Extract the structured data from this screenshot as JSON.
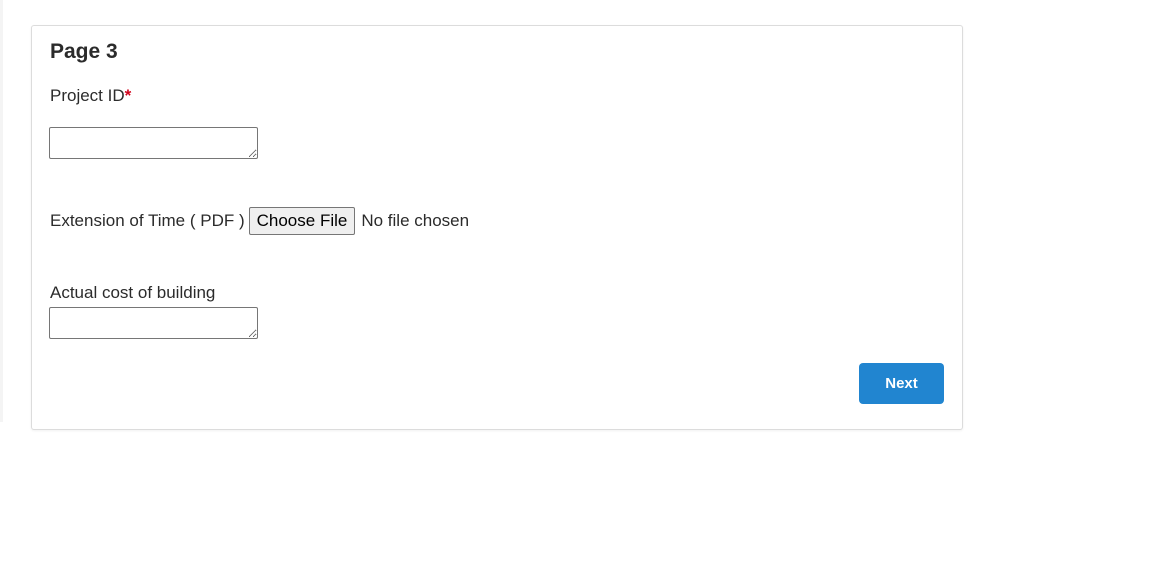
{
  "page": {
    "title": "Page 3"
  },
  "fields": {
    "project_id": {
      "label": "Project ID",
      "required_marker": "*",
      "value": ""
    },
    "extension_of_time": {
      "label": "Extension of Time ( PDF )",
      "button_label": "Choose File",
      "status_text": "No file chosen"
    },
    "actual_cost": {
      "label": "Actual cost of building",
      "value": ""
    }
  },
  "actions": {
    "next_label": "Next"
  },
  "colors": {
    "primary_button": "#2185d0",
    "required_marker": "#d0021b"
  }
}
